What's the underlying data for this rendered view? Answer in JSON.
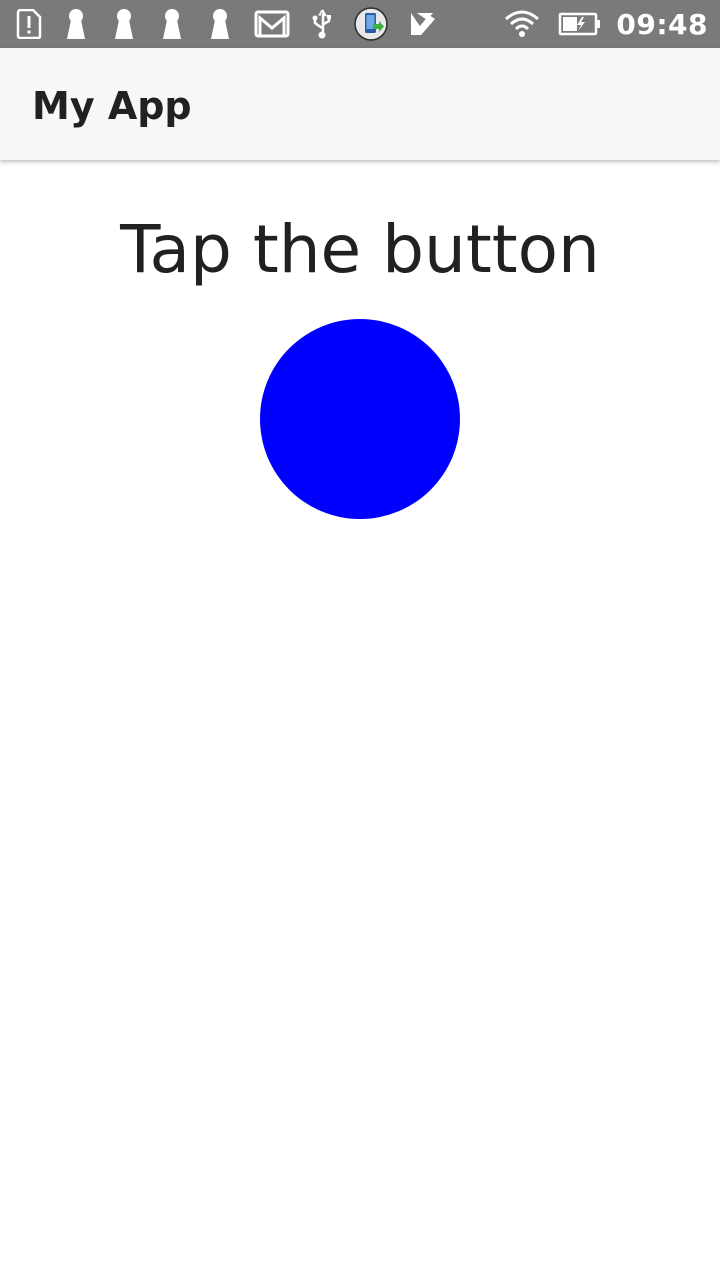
{
  "status_bar": {
    "time": "09:48",
    "left_icons": [
      "alert-sim-icon",
      "keyhole-icon",
      "keyhole-icon",
      "keyhole-icon",
      "keyhole-icon",
      "gmail-icon",
      "usb-icon",
      "app-update-icon",
      "check-flag-icon"
    ],
    "right_icons": [
      "wifi-icon",
      "battery-charging-icon"
    ]
  },
  "app_bar": {
    "title": "My App"
  },
  "main": {
    "prompt": "Tap the button",
    "button_color": "#0000ff"
  },
  "colors": {
    "status_bar_bg": "#7a7a7a",
    "app_bar_bg": "#f7f7f7",
    "text": "#212121",
    "button": "#0000ff"
  }
}
